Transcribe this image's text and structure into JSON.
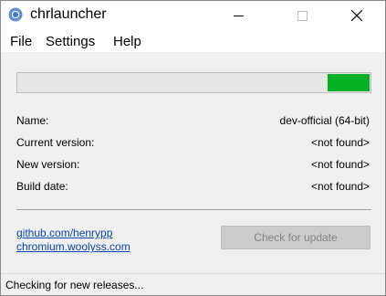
{
  "window": {
    "title": "chrlauncher",
    "icon": "chromium-icon"
  },
  "menu": [
    "File",
    "Settings",
    "Help"
  ],
  "progress": {
    "fraction": 0.12,
    "color": "#06b025"
  },
  "info": [
    {
      "label": "Name:",
      "value": "dev-official (64-bit)"
    },
    {
      "label": "Current version:",
      "value": "<not found>"
    },
    {
      "label": "New version:",
      "value": "<not found>"
    },
    {
      "label": "Build date:",
      "value": "<not found>"
    }
  ],
  "links": [
    "github.com/henrypp",
    "chromium.woolyss.com"
  ],
  "check_button": {
    "label": "Check for update",
    "enabled": false
  },
  "status": "Checking for new releases..."
}
